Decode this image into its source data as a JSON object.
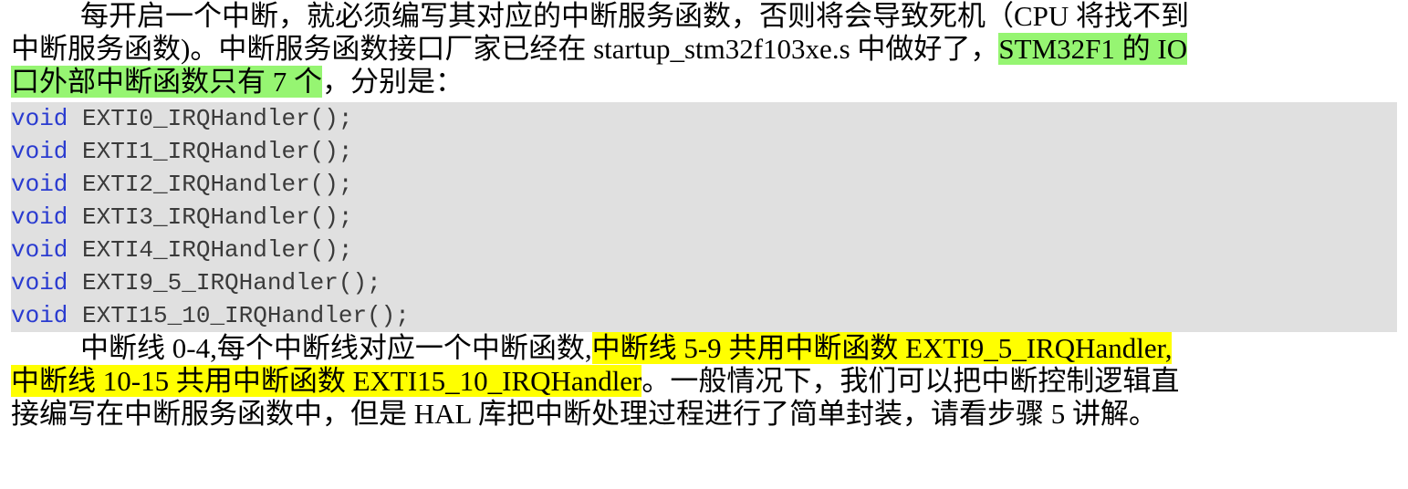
{
  "paragraph1": {
    "line1": "每开启一个中断，就必须编写其对应的中断服务函数，否则将会导致死机（CPU 将找不到",
    "line2_plain": "中断服务函数)。中断服务函数接口厂家已经在 startup_stm32f103xe.s 中做好了，",
    "line2_highlight": "STM32F1 的 IO",
    "line3_highlight": "口外部中断函数只有 7 个",
    "line3_plain": "，分别是："
  },
  "code": {
    "keyword": "void",
    "lines": [
      " EXTI0_IRQHandler();",
      " EXTI1_IRQHandler();",
      " EXTI2_IRQHandler();",
      " EXTI3_IRQHandler();",
      " EXTI4_IRQHandler();",
      " EXTI9_5_IRQHandler();",
      " EXTI15_10_IRQHandler();"
    ],
    "colors": {
      "keyword": "#2a3bd0",
      "text": "#3a3a3a",
      "background": "#e0e0e0"
    }
  },
  "paragraph2": {
    "line1_plain": "中断线 0-4,每个中断线对应一个中断函数,",
    "line1_highlight": "中断线 5-9 共用中断函数 EXTI9_5_IRQHandler,",
    "line2_highlight": "中断线 10-15 共用中断函数 EXTI15_10_IRQHandler",
    "line2_plain": "。一般情况下，我们可以把中断控制逻辑直",
    "line3": "接编写在中断服务函数中，但是 HAL 库把中断处理过程进行了简单封装，请看步骤 5 讲解。"
  },
  "highlight_colors": {
    "green": "#96f572",
    "yellow": "#ffff00"
  }
}
